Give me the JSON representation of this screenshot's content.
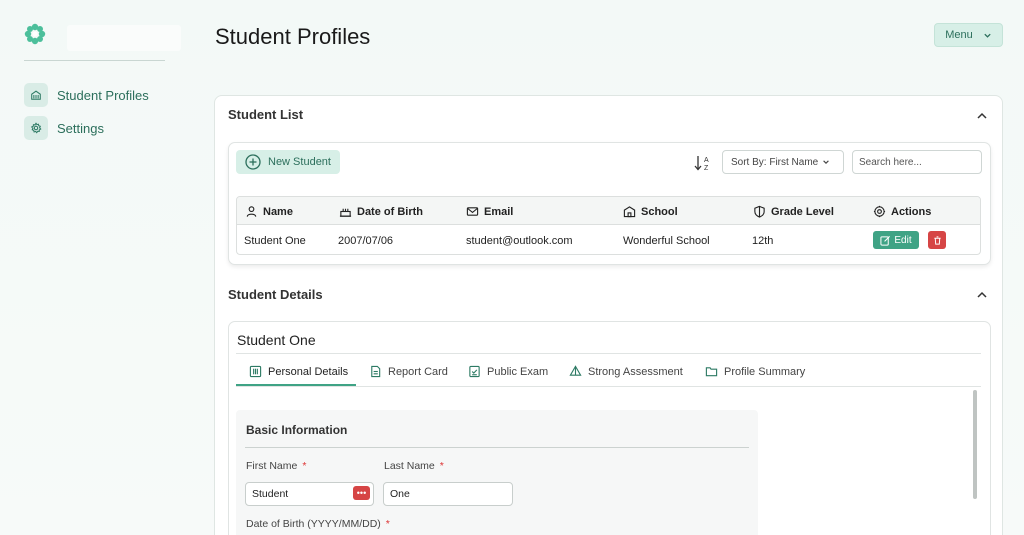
{
  "sidebar": {
    "logo": "flower-logo-icon",
    "items": [
      {
        "label": "Student Profiles",
        "icon": "building-icon"
      },
      {
        "label": "Settings",
        "icon": "gear-icon"
      }
    ]
  },
  "header": {
    "title": "Student Profiles",
    "menu_label": "Menu"
  },
  "student_list": {
    "title": "Student List",
    "new_button": "New Student",
    "sort_label": "Sort By: First Name",
    "search_placeholder": "Search here...",
    "columns": [
      "Name",
      "Date of Birth",
      "Email",
      "School",
      "Grade Level",
      "Actions"
    ],
    "rows": [
      {
        "name": "Student One",
        "dob": "2007/07/06",
        "email": "student@outlook.com",
        "school": "Wonderful School",
        "grade": "12th",
        "edit_label": "Edit"
      }
    ]
  },
  "student_details": {
    "title": "Student Details",
    "student_name": "Student One",
    "tabs": [
      "Personal Details",
      "Report Card",
      "Public Exam",
      "Strong Assessment",
      "Profile Summary"
    ],
    "active_tab": "Personal Details",
    "form": {
      "section_title": "Basic Information",
      "first_name_label": "First Name",
      "first_name_value": "Student",
      "last_name_label": "Last Name",
      "last_name_value": "One",
      "dob_label": "Date of Birth (YYYY/MM/DD)",
      "required_mark": "*"
    }
  },
  "colors": {
    "accent": "#3fa385",
    "accent_light": "#d7efe7",
    "danger": "#d64545"
  }
}
